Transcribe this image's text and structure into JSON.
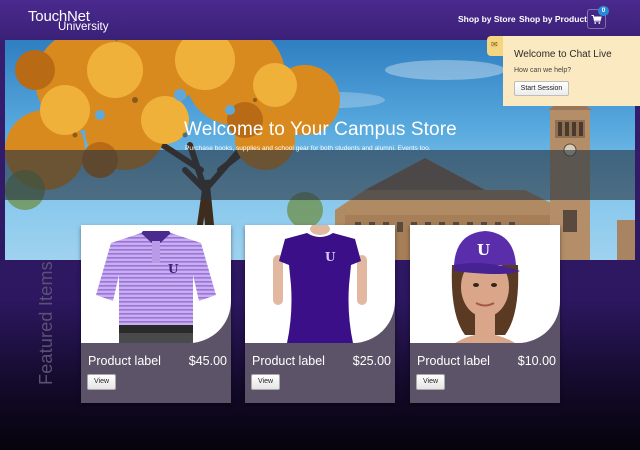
{
  "header": {
    "logo_line1": "TouchNet",
    "logo_line2": "University",
    "nav": [
      {
        "label": "Shop by Store"
      },
      {
        "label": "Shop by Product"
      }
    ],
    "cart_count": "0",
    "cart_icon": "shopping-cart-icon"
  },
  "hero": {
    "title": "Welcome to Your Campus Store",
    "subtitle": "Purchase books, supplies and school gear for both students and alumni. Events too."
  },
  "chat": {
    "icon": "speech-bubble-icon",
    "title": "Welcome to Chat Live",
    "prompt": "How can we help?",
    "button": "Start Session"
  },
  "featured": {
    "heading": "Featured Items",
    "products": [
      {
        "label": "Product label",
        "price": "$45.00",
        "button": "View",
        "image": "purple-striped-polo-shirt"
      },
      {
        "label": "Product label",
        "price": "$25.00",
        "button": "View",
        "image": "purple-t-shirt"
      },
      {
        "label": "Product label",
        "price": "$10.00",
        "button": "View",
        "image": "purple-baseball-cap"
      }
    ]
  },
  "colors": {
    "brand_purple": "#3b2077",
    "card_bg": "#5c5368",
    "chat_bg": "#fbe9c2",
    "badge_blue": "#2a88d8"
  }
}
